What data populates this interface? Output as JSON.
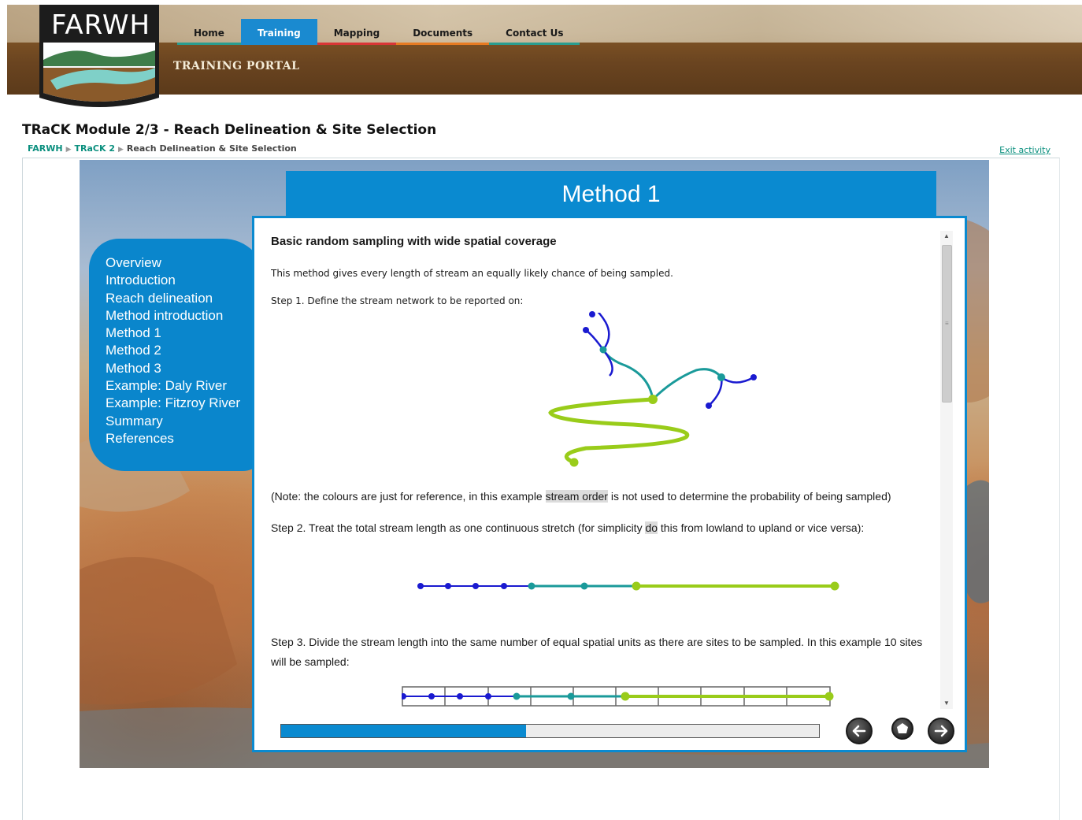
{
  "site": {
    "logo_text": "FARWH",
    "nav": [
      {
        "label": "Home",
        "accent": "#2a9d8f",
        "active": false
      },
      {
        "label": "Training",
        "accent": "#1a8ad0",
        "active": true
      },
      {
        "label": "Mapping",
        "accent": "#d93636",
        "active": false
      },
      {
        "label": "Documents",
        "accent": "#e77b22",
        "active": false
      },
      {
        "label": "Contact Us",
        "accent": "#2a9d8f",
        "active": false
      }
    ],
    "portal_title": "TRAINING PORTAL"
  },
  "module": {
    "title": "TRaCK Module 2/3 - Reach Delineation & Site Selection",
    "breadcrumb": [
      "FARWH",
      "TRaCK 2",
      "Reach Delineation & Site Selection"
    ],
    "exit_label": "Exit activity"
  },
  "menu": {
    "items": [
      "Overview",
      "Introduction",
      "Reach delineation",
      "Method introduction",
      "Method 1",
      "Method 2",
      "Method 3",
      "Example: Daly River",
      "Example: Fitzroy River",
      "Summary",
      "References"
    ]
  },
  "slide": {
    "header": "Method 1",
    "heading": "Basic random sampling with wide spatial coverage",
    "intro": "This method gives every length of stream an equally likely chance of being sampled.",
    "step1": "Step 1. Define the stream network to be reported on:",
    "note_a": "(Note: the colours are just for reference, in this example ",
    "note_hl": "stream order",
    "note_b": " is not used to determine the probability of being sampled)",
    "step2_a": "Step 2. Treat the total stream length as one continuous stretch (for simplicity ",
    "step2_hl": "do",
    "step2_b": " this from lowland to upland or vice versa):",
    "step3": "Step 3. Divide the stream length into the same number of equal spatial units as there are sites to be sampled. In this example 10 sites will be sampled:"
  },
  "progress": {
    "fraction": 0.455
  },
  "controls": {
    "back_icon": "arrow-left-icon",
    "home_icon": "home-icon",
    "next_icon": "arrow-right-icon"
  },
  "colors": {
    "order1": "#1a1ad0",
    "order2": "#1a9a9a",
    "order3": "#99cc1a",
    "accent": "#0a8ad0"
  }
}
